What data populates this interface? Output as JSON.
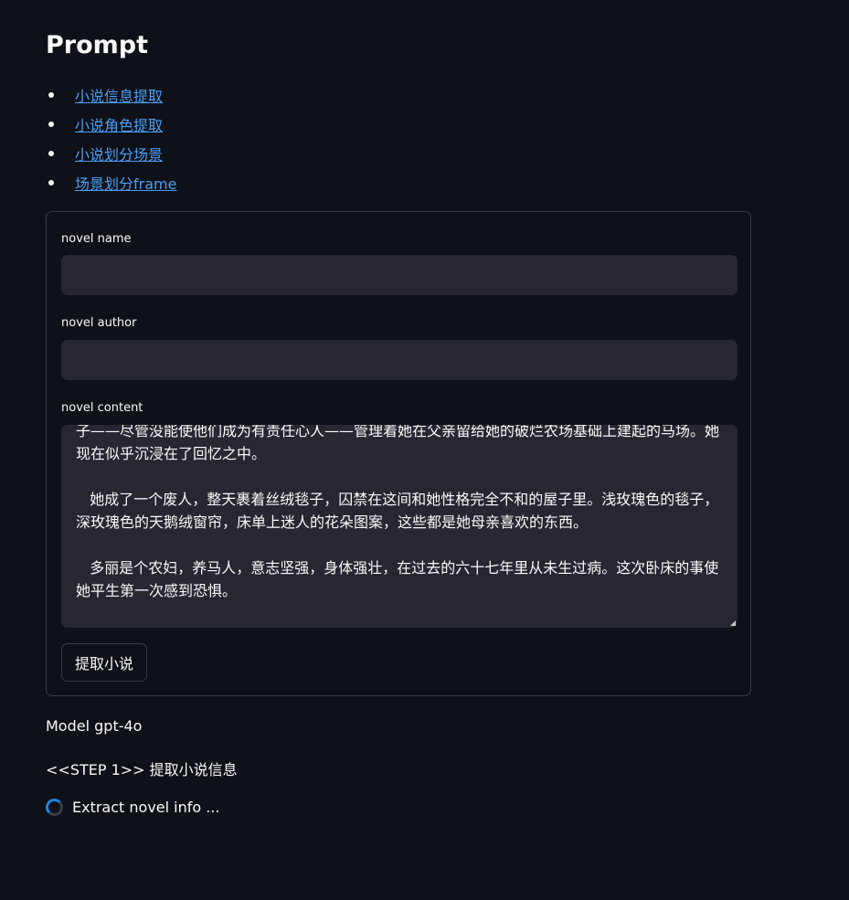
{
  "page": {
    "title": "Prompt"
  },
  "links": [
    {
      "label": "小说信息提取"
    },
    {
      "label": "小说角色提取"
    },
    {
      "label": "小说划分场景"
    },
    {
      "label": "场景划分frame"
    }
  ],
  "form": {
    "novel_name": {
      "label": "novel name",
      "value": ""
    },
    "novel_author": {
      "label": "novel author",
      "value": ""
    },
    "novel_content": {
      "label": "novel content",
      "value": "子——尽管没能使他们成为有责任心人——管理着她在父亲留给她的破烂农场基础上建起的马场。她现在似乎沉浸在了回忆之中。\n\n   她成了一个废人，整天裹着丝绒毯子，囚禁在这间和她性格完全不和的屋子里。浅玫瑰色的毯子，深玫瑰色的天鹅绒窗帘，床单上迷人的花朵图案，这些都是她母亲喜欢的东西。\n\n   多丽是个农妇，养马人，意志坚强，身体强壮，在过去的六十七年里从未生过病。这次卧床的事使她平生第一次感到恐惧。"
    },
    "submit_label": "提取小说"
  },
  "status": {
    "model": "Model gpt-4o",
    "step": "<<STEP 1>> 提取小说信息",
    "progress_text": "Extract novel info ..."
  },
  "colors": {
    "background": "#0e1117",
    "link": "#4a9ef5",
    "input_bg": "#262730",
    "spinner_accent": "#1c83e1"
  }
}
